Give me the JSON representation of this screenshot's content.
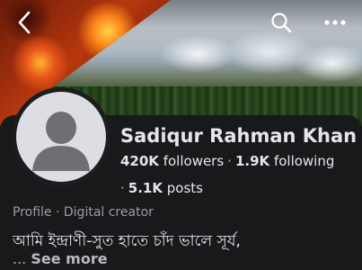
{
  "header": {
    "back_icon": "chevron-left-icon",
    "search_icon": "search-icon",
    "more_icon": "more-horizontal-icon"
  },
  "profile": {
    "name": "Sadiqur Rahman Khan",
    "followers_count": "420K",
    "followers_label": "followers",
    "following_count": "1.9K",
    "following_label": "following",
    "separator": "·",
    "posts_count": "5.1K",
    "posts_label": "posts",
    "category": "Profile · Digital creator",
    "bio": "আমি ইন্দ্রাণী-সুত হাতে চাঁদ ভালে সূর্য,",
    "ellipsis": "...",
    "see_more": "See more"
  },
  "colors": {
    "background": "#18191a",
    "text_primary": "#e4e6eb",
    "text_secondary": "#9b9ea3"
  }
}
